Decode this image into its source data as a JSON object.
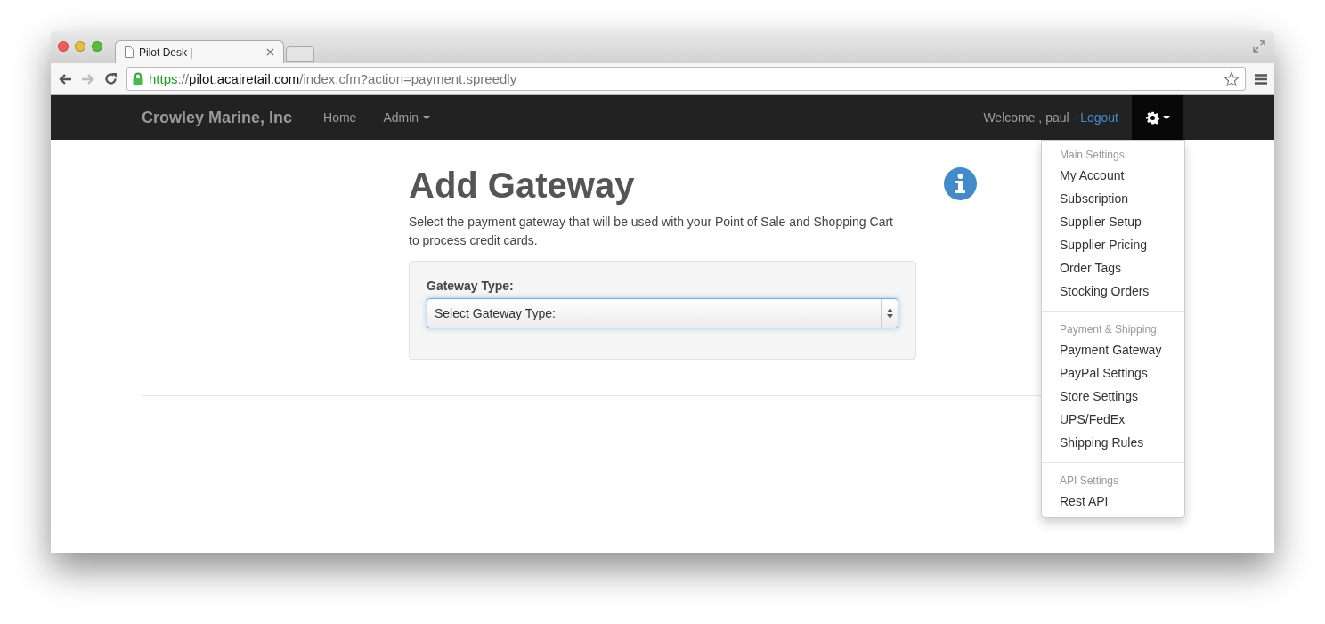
{
  "browser": {
    "tab": {
      "title": "Pilot Desk |",
      "selected": true
    },
    "address": {
      "scheme": "https",
      "separator": "://",
      "host": "pilot.acairetail.com",
      "path": "/index.cfm?action=payment.spreedly"
    }
  },
  "navbar": {
    "brand": "Crowley Marine, Inc",
    "links": [
      {
        "label": "Home",
        "dropdown": false
      },
      {
        "label": "Admin",
        "dropdown": true
      }
    ],
    "welcome": "Welcome , paul -",
    "logout": "Logout"
  },
  "settings_menu": {
    "open": true,
    "sections": [
      {
        "header": "Main Settings",
        "items": [
          "My Account",
          "Subscription",
          "Supplier Setup",
          "Supplier Pricing",
          "Order Tags",
          "Stocking Orders"
        ]
      },
      {
        "header": "Payment & Shipping",
        "items": [
          "Payment Gateway",
          "PayPal Settings",
          "Store Settings",
          "UPS/FedEx",
          "Shipping Rules"
        ]
      },
      {
        "header": "API Settings",
        "items": [
          "Rest API"
        ]
      }
    ]
  },
  "page": {
    "title": "Add Gateway",
    "description": "Select the payment gateway that will be used with your Point of Sale and Shopping Cart to process credit cards.",
    "form": {
      "label": "Gateway Type:",
      "select": "Select Gateway Type:",
      "focused": true
    }
  }
}
